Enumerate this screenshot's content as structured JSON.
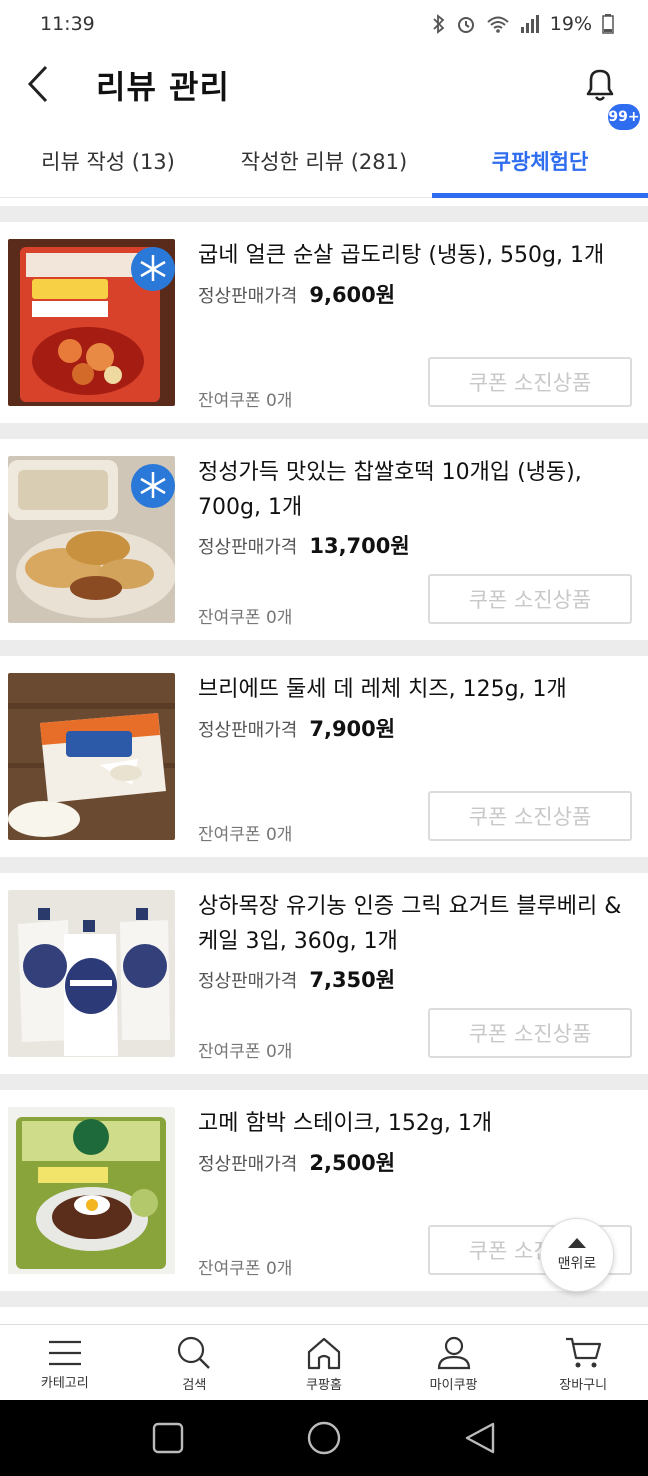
{
  "status_bar": {
    "time": "11:39",
    "battery": "19%"
  },
  "header": {
    "title": "리뷰 관리",
    "badge": "99+"
  },
  "tabs": [
    {
      "label": "리뷰 작성 (13)"
    },
    {
      "label": "작성한 리뷰 (281)"
    },
    {
      "label": "쿠팡체험단"
    }
  ],
  "products": [
    {
      "name": "굽네 얼큰 순살 곱도리탕 (냉동), 550g, 1개",
      "price_label": "정상판매가격",
      "price": "9,600원",
      "coupon_remain": "잔여쿠폰 0개",
      "button": "쿠폰 소진상품"
    },
    {
      "name": "정성가득 맛있는 찹쌀호떡 10개입 (냉동), 700g, 1개",
      "price_label": "정상판매가격",
      "price": "13,700원",
      "coupon_remain": "잔여쿠폰 0개",
      "button": "쿠폰 소진상품"
    },
    {
      "name": "브리에뜨 둘세 데 레체 치즈, 125g, 1개",
      "price_label": "정상판매가격",
      "price": "7,900원",
      "coupon_remain": "잔여쿠폰 0개",
      "button": "쿠폰 소진상품"
    },
    {
      "name": "상하목장 유기농 인증 그릭 요거트 블루베리 & 케일 3입, 360g, 1개",
      "price_label": "정상판매가격",
      "price": "7,350원",
      "coupon_remain": "잔여쿠폰 0개",
      "button": "쿠폰 소진상품"
    },
    {
      "name": "고메 함박 스테이크, 152g, 1개",
      "price_label": "정상판매가격",
      "price": "2,500원",
      "coupon_remain": "잔여쿠폰 0개",
      "button": "쿠폰 소진상품"
    }
  ],
  "to_top": {
    "label": "맨위로"
  },
  "bottom_nav": [
    {
      "label": "카테고리",
      "icon": "menu-icon"
    },
    {
      "label": "검색",
      "icon": "search-icon"
    },
    {
      "label": "쿠팡홈",
      "icon": "home-icon"
    },
    {
      "label": "마이쿠팡",
      "icon": "user-icon"
    },
    {
      "label": "장바구니",
      "icon": "cart-icon"
    }
  ],
  "colors": {
    "accent": "#2f6df0",
    "divider": "#ececec"
  }
}
